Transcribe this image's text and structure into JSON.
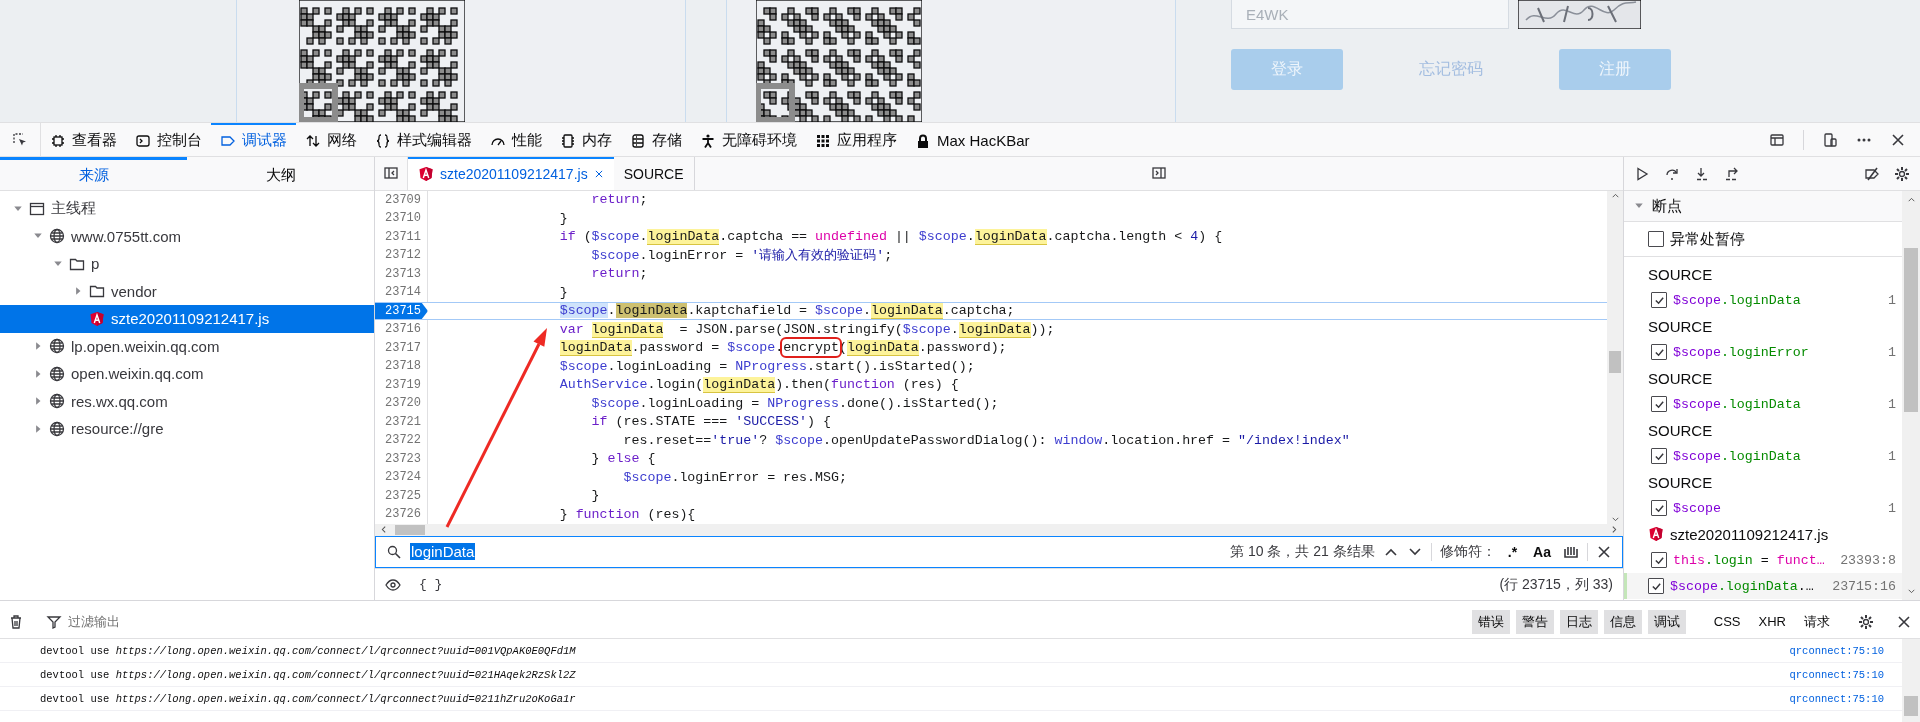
{
  "page": {
    "captcha_input": "E4WK",
    "buttons": [
      {
        "label": "登录",
        "kind": "primary"
      },
      {
        "label": "忘记密码",
        "kind": "link"
      },
      {
        "label": "注册",
        "kind": "primary"
      }
    ]
  },
  "toolbar": {
    "tools": [
      {
        "label": "查看器",
        "kind": "inspector",
        "selected": false
      },
      {
        "label": "控制台",
        "kind": "console",
        "selected": false
      },
      {
        "label": "调试器",
        "kind": "debugger",
        "selected": true
      },
      {
        "label": "网络",
        "kind": "network",
        "selected": false
      },
      {
        "label": "样式编辑器",
        "kind": "style",
        "selected": false
      },
      {
        "label": "性能",
        "kind": "performance",
        "selected": false
      },
      {
        "label": "内存",
        "kind": "memory",
        "selected": false
      },
      {
        "label": "存储",
        "kind": "storage",
        "selected": false
      },
      {
        "label": "无障碍环境",
        "kind": "accessibility",
        "selected": false
      },
      {
        "label": "应用程序",
        "kind": "application",
        "selected": false
      },
      {
        "label": "Max HacKBar",
        "kind": "hackbar",
        "selected": false
      }
    ]
  },
  "source_tabs": [
    {
      "label": "来源",
      "selected": true
    },
    {
      "label": "大纲",
      "selected": false
    }
  ],
  "source_tree": [
    {
      "label": "主线程",
      "kind": "thread",
      "expanded": true,
      "selected": false,
      "children": [
        {
          "label": "www.0755tt.com",
          "kind": "domain",
          "expanded": true,
          "selected": false,
          "children": [
            {
              "label": "p",
              "kind": "folder",
              "expanded": true,
              "selected": false,
              "children": [
                {
                  "label": "vendor",
                  "kind": "folder",
                  "expanded": false,
                  "selected": false
                },
                {
                  "label": "szte20201109212417.js",
                  "kind": "file",
                  "selected": true
                }
              ]
            }
          ]
        },
        {
          "label": "lp.open.weixin.qq.com",
          "kind": "domain",
          "expanded": false,
          "selected": false
        },
        {
          "label": "open.weixin.qq.com",
          "kind": "domain",
          "expanded": false,
          "selected": false
        },
        {
          "label": "res.wx.qq.com",
          "kind": "domain",
          "expanded": false,
          "selected": false
        },
        {
          "label": "resource://gre",
          "kind": "domain",
          "expanded": false,
          "selected": false
        }
      ]
    }
  ],
  "editor_tabs": [
    {
      "label": "szte20201109212417.js",
      "kind": "file",
      "selected": true
    },
    {
      "label": "SOURCE",
      "kind": "plain",
      "selected": false
    }
  ],
  "code": {
    "lines": [
      {
        "number": "23709",
        "breakpoint": false,
        "segments": [
          {
            "t": "                    return",
            "kind": "keyword"
          },
          {
            "t": ";"
          }
        ]
      },
      {
        "number": "23710",
        "breakpoint": false,
        "segments": [
          {
            "t": "                }"
          }
        ]
      },
      {
        "number": "23711",
        "breakpoint": false,
        "segments": [
          {
            "t": "                if",
            "kind": "keyword"
          },
          {
            "t": " ("
          },
          {
            "t": "$scope",
            "kind": "variable"
          },
          {
            "t": "."
          },
          {
            "t": "loginData",
            "kind": "match"
          },
          {
            "t": ".captcha == "
          },
          {
            "t": "undefined",
            "kind": "literal"
          },
          {
            "t": " || "
          },
          {
            "t": "$scope",
            "kind": "variable"
          },
          {
            "t": "."
          },
          {
            "t": "loginData",
            "kind": "match"
          },
          {
            "t": ".captcha.length < "
          },
          {
            "t": "4",
            "kind": "number"
          },
          {
            "t": ") {"
          }
        ]
      },
      {
        "number": "23712",
        "breakpoint": false,
        "segments": [
          {
            "t": "                    $scope",
            "kind": "variable"
          },
          {
            "t": ".loginError = "
          },
          {
            "t": "'请输入有效的验证码'",
            "kind": "string"
          },
          {
            "t": ";"
          }
        ]
      },
      {
        "number": "23713",
        "breakpoint": false,
        "segments": [
          {
            "t": "                    return",
            "kind": "keyword"
          },
          {
            "t": ";"
          }
        ]
      },
      {
        "number": "23714",
        "breakpoint": false,
        "segments": [
          {
            "t": "                }"
          }
        ]
      },
      {
        "number": "23715",
        "breakpoint": true,
        "segments": [
          {
            "t": "                $scope",
            "kind": "paused-variable"
          },
          {
            "t": "."
          },
          {
            "t": "loginData",
            "kind": "current-match"
          },
          {
            "t": ".kaptchafield = "
          },
          {
            "t": "$scope",
            "kind": "variable"
          },
          {
            "t": "."
          },
          {
            "t": "loginData",
            "kind": "match"
          },
          {
            "t": ".captcha;"
          }
        ]
      },
      {
        "number": "23716",
        "breakpoint": false,
        "segments": [
          {
            "t": "                var ",
            "kind": "keyword"
          },
          {
            "t": "loginData",
            "kind": "match"
          },
          {
            "t": "  = JSON.parse(JSON.stringify("
          },
          {
            "t": "$scope",
            "kind": "variable"
          },
          {
            "t": "."
          },
          {
            "t": "loginData",
            "kind": "match"
          },
          {
            "t": "));"
          }
        ]
      },
      {
        "number": "23717",
        "breakpoint": false,
        "segments": [
          {
            "t": "                loginData",
            "kind": "match"
          },
          {
            "t": ".password = "
          },
          {
            "t": "$scope",
            "kind": "variable"
          },
          {
            "t": "."
          },
          {
            "t": "encrypt",
            "kind": "boxed"
          },
          {
            "t": "("
          },
          {
            "t": "loginData",
            "kind": "match"
          },
          {
            "t": ".password);"
          }
        ]
      },
      {
        "number": "23718",
        "breakpoint": false,
        "segments": [
          {
            "t": "                $scope",
            "kind": "variable"
          },
          {
            "t": ".loginLoading = "
          },
          {
            "t": "NProgress",
            "kind": "variable"
          },
          {
            "t": ".start().isStarted();"
          }
        ]
      },
      {
        "number": "23719",
        "breakpoint": false,
        "segments": [
          {
            "t": "                AuthService",
            "kind": "variable"
          },
          {
            "t": ".login("
          },
          {
            "t": "loginData",
            "kind": "match"
          },
          {
            "t": ").then("
          },
          {
            "t": "function",
            "kind": "keyword"
          },
          {
            "t": " (res) {"
          }
        ]
      },
      {
        "number": "23720",
        "breakpoint": false,
        "segments": [
          {
            "t": "                    $scope",
            "kind": "variable"
          },
          {
            "t": ".loginLoading = "
          },
          {
            "t": "NProgress",
            "kind": "variable"
          },
          {
            "t": ".done().isStarted();"
          }
        ]
      },
      {
        "number": "23721",
        "breakpoint": false,
        "segments": [
          {
            "t": "                    if",
            "kind": "keyword"
          },
          {
            "t": " (res.STATE === "
          },
          {
            "t": "'SUCCESS'",
            "kind": "string"
          },
          {
            "t": ") {"
          }
        ]
      },
      {
        "number": "23722",
        "breakpoint": false,
        "segments": [
          {
            "t": "                        res.reset=="
          },
          {
            "t": "'true'",
            "kind": "string"
          },
          {
            "t": "? "
          },
          {
            "t": "$scope",
            "kind": "variable"
          },
          {
            "t": ".openUpdatePasswordDialog(): "
          },
          {
            "t": "window",
            "kind": "variable"
          },
          {
            "t": ".location.href = "
          },
          {
            "t": "\"/index!index\"",
            "kind": "string"
          }
        ]
      },
      {
        "number": "23723",
        "breakpoint": false,
        "segments": [
          {
            "t": "                    } "
          },
          {
            "t": "else",
            "kind": "keyword"
          },
          {
            "t": " {"
          }
        ]
      },
      {
        "number": "23724",
        "breakpoint": false,
        "segments": [
          {
            "t": "                        $scope",
            "kind": "variable"
          },
          {
            "t": ".loginError = res.MSG;"
          }
        ]
      },
      {
        "number": "23725",
        "breakpoint": false,
        "segments": [
          {
            "t": "                    }"
          }
        ]
      },
      {
        "number": "23726",
        "breakpoint": false,
        "segments": [
          {
            "t": "                } "
          },
          {
            "t": "function",
            "kind": "keyword"
          },
          {
            "t": " (res){"
          }
        ]
      }
    ]
  },
  "search": {
    "query": "loginData",
    "results": "第 10 条，共 21 条结果",
    "modifiers_label": "修饰符：",
    "modifiers": [
      ".*",
      "Aa"
    ]
  },
  "watch": {
    "pretty_print": "{ }",
    "position": "(行 23715，列 33)"
  },
  "breakpoints": {
    "title": "断点",
    "expanded": true,
    "pause_on_exceptions": {
      "label": "异常处暂停",
      "checked": false
    },
    "groups": [
      {
        "kind": "source",
        "label": "SOURCE",
        "items": [
          {
            "checked": true,
            "selected": false,
            "location": "1",
            "expression": [
              {
                "t": "$scope",
                "kind": "object"
              },
              {
                "t": ".loginData",
                "kind": "property"
              }
            ]
          }
        ]
      },
      {
        "kind": "source",
        "label": "SOURCE",
        "items": [
          {
            "checked": true,
            "selected": false,
            "location": "1",
            "expression": [
              {
                "t": "$scope",
                "kind": "object"
              },
              {
                "t": ".loginError",
                "kind": "property"
              }
            ]
          }
        ]
      },
      {
        "kind": "source",
        "label": "SOURCE",
        "items": [
          {
            "checked": true,
            "selected": false,
            "location": "1",
            "expression": [
              {
                "t": "$scope",
                "kind": "object"
              },
              {
                "t": ".loginData",
                "kind": "property"
              }
            ]
          }
        ]
      },
      {
        "kind": "source",
        "label": "SOURCE",
        "items": [
          {
            "checked": true,
            "selected": false,
            "location": "1",
            "expression": [
              {
                "t": "$scope",
                "kind": "object"
              },
              {
                "t": ".loginData",
                "kind": "property"
              }
            ]
          }
        ]
      },
      {
        "kind": "source",
        "label": "SOURCE",
        "items": [
          {
            "checked": true,
            "selected": false,
            "location": "1",
            "expression": [
              {
                "t": "$scope",
                "kind": "object"
              }
            ]
          }
        ]
      },
      {
        "kind": "file",
        "label": "szte20201109212417.js",
        "items": [
          {
            "checked": true,
            "selected": false,
            "location": "23393:8",
            "expression": [
              {
                "t": "this",
                "kind": "keyword"
              },
              {
                "t": ".login",
                "kind": "property"
              },
              {
                "t": " = "
              },
              {
                "t": "funct…",
                "kind": "keyword"
              }
            ]
          },
          {
            "checked": true,
            "selected": true,
            "location": "23715:16",
            "expression": [
              {
                "t": "$scope",
                "kind": "object"
              },
              {
                "t": ".loginData",
                "kind": "property"
              },
              {
                "t": ".…"
              }
            ]
          }
        ]
      }
    ]
  },
  "console": {
    "filter_placeholder": "过滤输出",
    "levels": [
      {
        "label": "错误",
        "selected": true
      },
      {
        "label": "警告",
        "selected": true
      },
      {
        "label": "日志",
        "selected": true
      },
      {
        "label": "信息",
        "selected": true
      },
      {
        "label": "调试",
        "selected": true
      }
    ],
    "types": [
      {
        "label": "CSS",
        "selected": false
      },
      {
        "label": "XHR",
        "selected": false
      },
      {
        "label": "请求",
        "selected": false
      }
    ],
    "messages": [
      {
        "text": "devtool use *https://long.open.weixin.qq.com/connect/l/qrconnect?uuid=001VQpAK0E0QFd1M*",
        "location": "qrconnect:75:10"
      },
      {
        "text": "devtool use *https://long.open.weixin.qq.com/connect/l/qrconnect?uuid=021HAqek2RzSkl2Z*",
        "location": "qrconnect:75:10"
      },
      {
        "text": "devtool use *https://long.open.weixin.qq.com/connect/l/qrconnect?uuid=0211hZru2oKoGa1r*",
        "location": "qrconnect:75:10"
      }
    ]
  }
}
